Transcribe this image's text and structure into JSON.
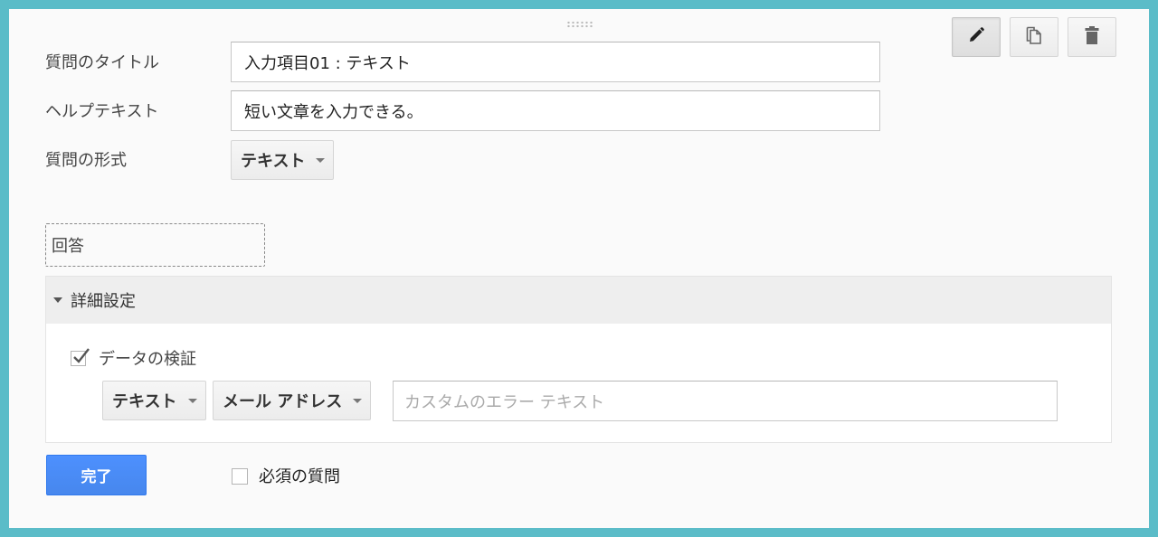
{
  "form": {
    "title_label": "質問のタイトル",
    "title_value": "入力項目01 : テキスト",
    "help_label": "ヘルプテキスト",
    "help_value": "短い文章を入力できる。",
    "type_label": "質問の形式",
    "type_value": "テキスト",
    "answer_label": "回答"
  },
  "toolbar": {
    "edit_icon": "pencil-icon",
    "duplicate_icon": "duplicate-icon",
    "delete_icon": "trash-icon",
    "active_tool": "edit"
  },
  "advanced": {
    "header": "詳細設定",
    "expanded": true,
    "validation_label": "データの検証",
    "validation_checked": true,
    "rule_type": "テキスト",
    "rule_subtype": "メール アドレス",
    "error_placeholder": "カスタムのエラー テキスト"
  },
  "footer": {
    "done_label": "完了",
    "required_label": "必須の質問",
    "required_checked": false
  },
  "colors": {
    "accent": "#4d90fe",
    "frame": "#5bbcc8"
  }
}
